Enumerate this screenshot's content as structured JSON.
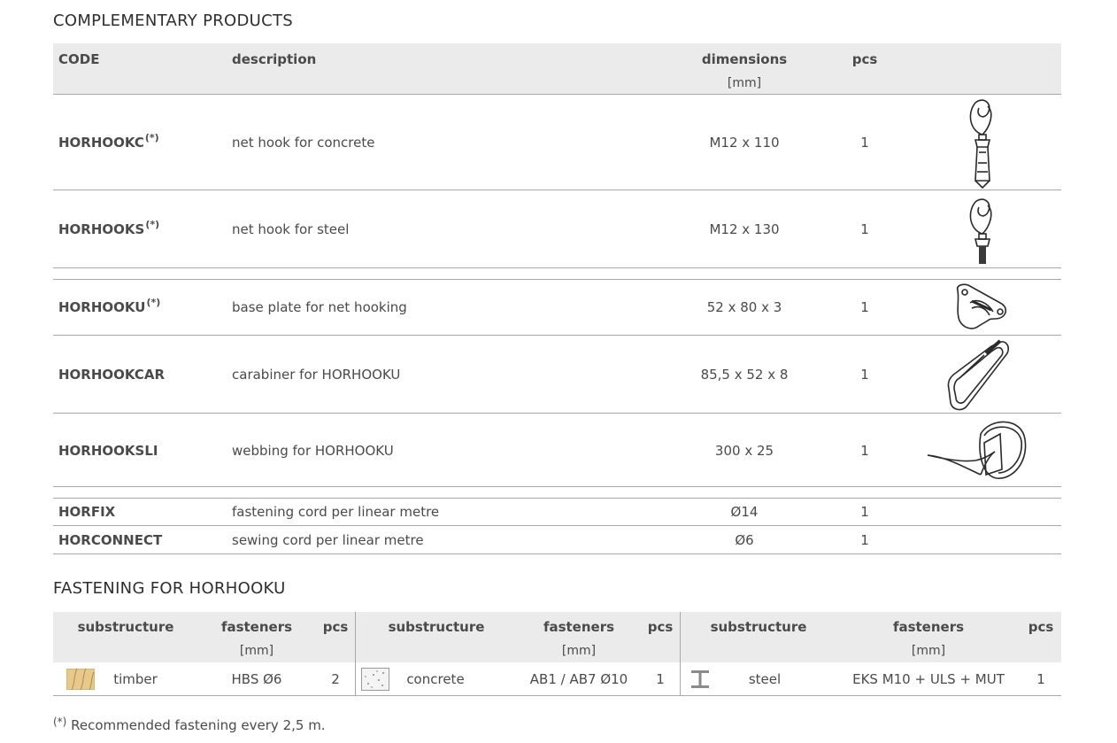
{
  "section1": {
    "title": "COMPLEMENTARY PRODUCTS",
    "headers": {
      "code": "CODE",
      "description": "description",
      "dimensions": "dimensions",
      "dimensions_unit": "[mm]",
      "pcs": "pcs"
    },
    "rows": [
      {
        "code": "HORHOOKC",
        "sup": "(*)",
        "description": "net hook for concrete",
        "dimensions": "M12 x 110",
        "pcs": "1",
        "image": "net-hook-concrete-drawing"
      },
      {
        "code": "HORHOOKS",
        "sup": "(*)",
        "description": "net hook for steel",
        "dimensions": "M12 x 130",
        "pcs": "1",
        "image": "net-hook-steel-drawing"
      },
      {
        "code": "HORHOOKU",
        "sup": "(*)",
        "description": "base plate for net hooking",
        "dimensions": "52 x 80 x 3",
        "pcs": "1",
        "image": "base-plate-drawing"
      },
      {
        "code": "HORHOOKCAR",
        "sup": "",
        "description": "carabiner for HORHOOKU",
        "dimensions": "85,5 x 52 x 8",
        "pcs": "1",
        "image": "carabiner-drawing"
      },
      {
        "code": "HORHOOKSLI",
        "sup": "",
        "description": "webbing for HORHOOKU",
        "dimensions": "300 x 25",
        "pcs": "1",
        "image": "webbing-drawing"
      },
      {
        "code": "HORFIX",
        "sup": "",
        "description": "fastening cord per linear metre",
        "dimensions": "Ø14",
        "pcs": "1"
      },
      {
        "code": "HORCONNECT",
        "sup": "",
        "description": "sewing cord per linear metre",
        "dimensions": "Ø6",
        "pcs": "1"
      }
    ]
  },
  "section2": {
    "title": "FASTENING FOR HORHOOKU",
    "headers": {
      "substructure": "substructure",
      "fasteners": "fasteners",
      "unit": "[mm]",
      "pcs": "pcs"
    },
    "groups": [
      {
        "substructure": "timber",
        "fasteners": "HBS Ø6",
        "pcs": "2",
        "icon": "timber-icon"
      },
      {
        "substructure": "concrete",
        "fasteners": "AB1 / AB7 Ø10",
        "pcs": "1",
        "icon": "concrete-icon"
      },
      {
        "substructure": "steel",
        "fasteners": "EKS M10 + ULS + MUT",
        "pcs": "1",
        "icon": "steel-beam-icon"
      }
    ]
  },
  "footnote": {
    "sup": "(*)",
    "text": "Recommended fastening every 2,5 m."
  },
  "colors": {
    "header_bg": "#ebebeb",
    "rule": "#a8a8a8",
    "text": "#4a4a4a",
    "timber": "#e8c98c"
  }
}
